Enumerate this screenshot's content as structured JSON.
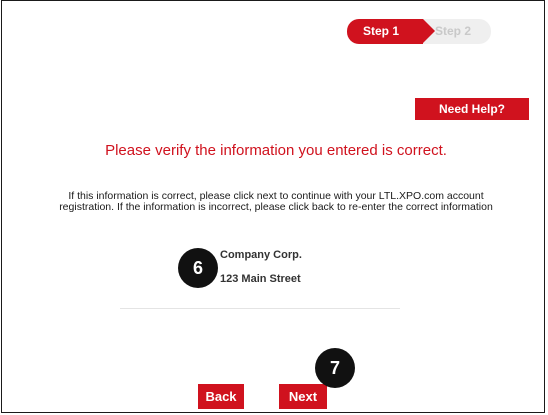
{
  "steps": {
    "active_label": "Step 1",
    "inactive_label": "Step 2"
  },
  "help": {
    "label": "Need Help?"
  },
  "verify": {
    "heading": "Please verify the information you entered is correct.",
    "instructions": "If this information is correct, please click next to continue with your LTL.XPO.com account registration. If the information is incorrect, please click back to re-enter the correct information"
  },
  "company": {
    "name": "Company Corp.",
    "address": "123 Main Street"
  },
  "callouts": {
    "company_marker": "6",
    "next_marker": "7"
  },
  "actions": {
    "back_label": "Back",
    "next_label": "Next"
  },
  "colors": {
    "accent": "#d0121e",
    "step_inactive_bg": "#efefef",
    "marker_bg": "#111111"
  }
}
